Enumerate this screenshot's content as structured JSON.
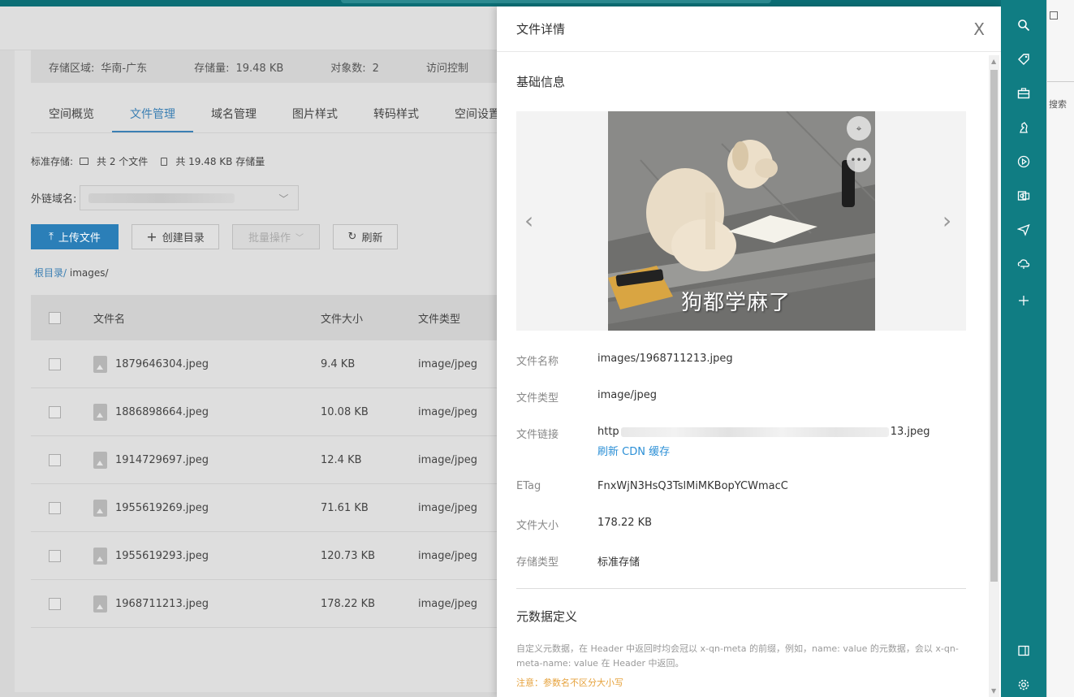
{
  "info_bar": {
    "region_label": "存储区域:",
    "region_value": "华南-广东",
    "size_label": "存储量:",
    "size_value": "19.48 KB",
    "objects_label": "对象数:",
    "objects_value": "2",
    "access_label": "访问控制"
  },
  "tabs": [
    "空间概览",
    "文件管理",
    "域名管理",
    "图片样式",
    "转码样式",
    "空间设置"
  ],
  "storage": {
    "label": "标准存储:",
    "files": "共 2 个文件",
    "usage": "共 19.48 KB 存储量"
  },
  "domain": {
    "label": "外链域名:"
  },
  "buttons": {
    "upload": "上传文件",
    "create_dir": "创建目录",
    "batch": "批量操作",
    "refresh": "刷新"
  },
  "breadcrumb": {
    "root": "根目录/",
    "current": "images/"
  },
  "table": {
    "headers": {
      "name": "文件名",
      "size": "文件大小",
      "type": "文件类型"
    },
    "rows": [
      {
        "name": "1879646304.jpeg",
        "size": "9.4 KB",
        "type": "image/jpeg"
      },
      {
        "name": "1886898664.jpeg",
        "size": "10.08 KB",
        "type": "image/jpeg"
      },
      {
        "name": "1914729697.jpeg",
        "size": "12.4 KB",
        "type": "image/jpeg"
      },
      {
        "name": "1955619269.jpeg",
        "size": "71.61 KB",
        "type": "image/jpeg"
      },
      {
        "name": "1955619293.jpeg",
        "size": "120.73 KB",
        "type": "image/jpeg"
      },
      {
        "name": "1968711213.jpeg",
        "size": "178.22 KB",
        "type": "image/jpeg"
      }
    ]
  },
  "drawer": {
    "title": "文件详情",
    "close": "X",
    "basic_title": "基础信息",
    "caption": "狗都学麻了",
    "fields": {
      "name_label": "文件名称",
      "name_value": "images/1968711213.jpeg",
      "type_label": "文件类型",
      "type_value": "image/jpeg",
      "link_label": "文件链接",
      "link_prefix": "http",
      "link_suffix": "13.jpeg",
      "refresh_cdn": "刷新 CDN 缓存",
      "etag_label": "ETag",
      "etag_value": "FnxWjN3HsQ3TslMiMKBopYCWmacC",
      "size_label": "文件大小",
      "size_value": "178.22 KB",
      "storage_label": "存储类型",
      "storage_value": "标准存储"
    },
    "meta_title": "元数据定义",
    "meta_desc": "自定义元数据，在 Header 中返回时均会冠以 x-qn-meta 的前缀，例如，name: value 的元数据，会以 x-qn-meta-name: value 在 Header 中返回。",
    "meta_warn": "注意：参数名不区分大小写"
  },
  "far_right": {
    "search_hint": "搜索"
  },
  "colors": {
    "accent": "#107d83",
    "primary_btn": "#2b7fb8",
    "link": "#2b8fd6",
    "warn": "#e6a23c"
  }
}
